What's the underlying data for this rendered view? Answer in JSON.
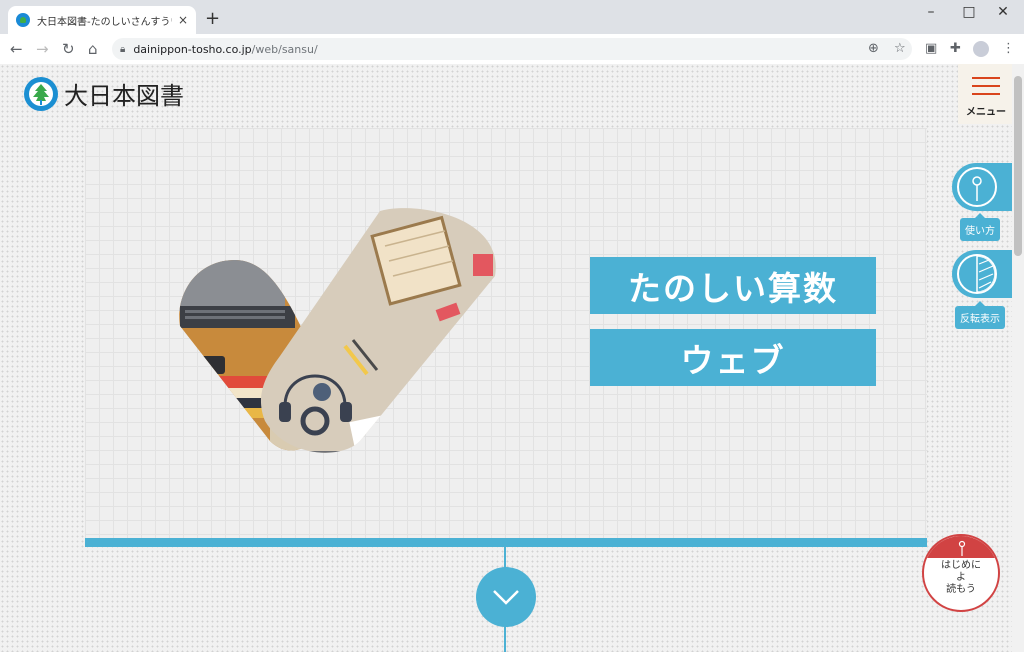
{
  "browser": {
    "tab_title": "大日本図書-たのしいさんすうウェブ",
    "tab_close": "×",
    "new_tab": "+",
    "minimize": "–",
    "maximize": "□",
    "close": "✕",
    "url_host": "dainippon-tosho.co.jp",
    "url_path": "/web/sansu/"
  },
  "header": {
    "logo_text": "大日本図書",
    "menu_label": "メニュー"
  },
  "hero": {
    "title_line1": "たのしい算数",
    "title_line2": "ウェブ"
  },
  "side_buttons": {
    "howto_label": "使い方",
    "invert_label": "反転表示"
  },
  "start_button": {
    "line1": "はじめに",
    "line2": "よ",
    "line3": "読もう"
  },
  "colors": {
    "accent": "#4bb1d4",
    "menu_accent": "#d9451d",
    "start_accent": "#d14343"
  }
}
